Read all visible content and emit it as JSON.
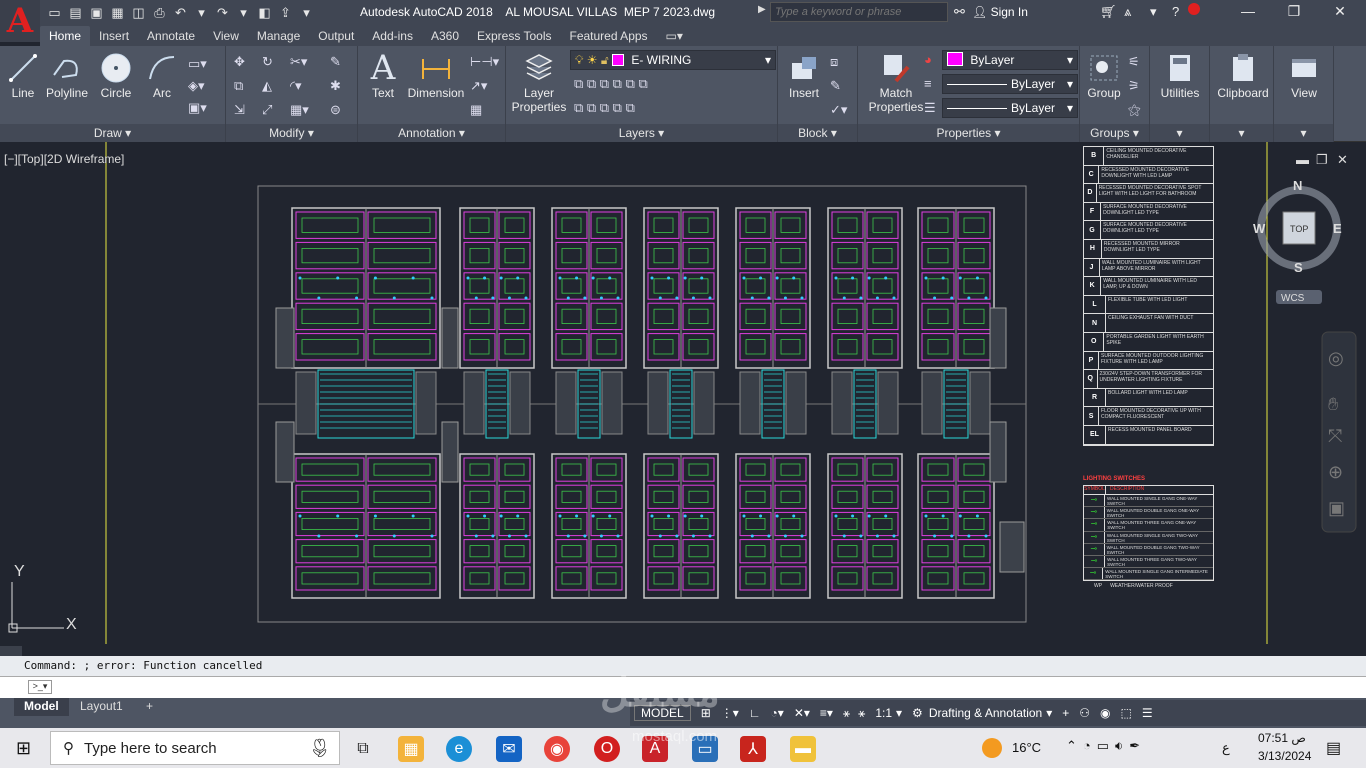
{
  "app": {
    "logo": "A",
    "title": "Autodesk AutoCAD 2018    AL MOUSAL VILLAS  MEP 7 2023.dwg"
  },
  "search": {
    "placeholder": "Type a keyword or phrase"
  },
  "account": {
    "signin": "Sign In"
  },
  "tabs": [
    "Home",
    "Insert",
    "Annotate",
    "View",
    "Manage",
    "Output",
    "Add-ins",
    "A360",
    "Express Tools",
    "Featured Apps"
  ],
  "draw": {
    "line": "Line",
    "polyline": "Polyline",
    "circle": "Circle",
    "arc": "Arc",
    "label": "Draw"
  },
  "modify": {
    "label": "Modify"
  },
  "annotation": {
    "text": "Text",
    "dimension": "Dimension",
    "label": "Annotation"
  },
  "layers": {
    "props1": "Layer",
    "props2": "Properties",
    "current": "E- WIRING",
    "label": "Layers"
  },
  "block": {
    "insert": "Insert",
    "label": "Block"
  },
  "properties": {
    "match1": "Match",
    "match2": "Properties",
    "color": "ByLayer",
    "linetype": "ByLayer",
    "lineweight": "ByLayer",
    "label": "Properties"
  },
  "groups": {
    "group": "Group",
    "label": "Groups"
  },
  "utilities": {
    "label": "Utilities"
  },
  "clipboard": {
    "label": "Clipboard"
  },
  "view": {
    "label": "View"
  },
  "viewport": {
    "label": "[−][Top][2D Wireframe]",
    "north": "N",
    "south": "S",
    "east": "E",
    "west": "W",
    "top": "TOP",
    "wcs": "WCS",
    "x": "X",
    "y": "Y"
  },
  "legend": {
    "rows": [
      {
        "sym": "B",
        "text": "CEILING MOUNTED DECORATIVE CHANDELIER"
      },
      {
        "sym": "C",
        "text": "RECESSED MOUNTED DECORATIVE DOWNLIGHT WITH LED LAMP"
      },
      {
        "sym": "D",
        "text": "RECESSED MOUNTED DECORATIVE SPOT LIGHT WITH LED LIGHT FOR BATHROOM"
      },
      {
        "sym": "F",
        "text": "SURFACE MOUNTED DECORATIVE DOWNLIGHT LED TYPE"
      },
      {
        "sym": "G",
        "text": "SURFACE MOUNTED DECORATIVE DOWNLIGHT LED TYPE"
      },
      {
        "sym": "H",
        "text": "RECESSED MOUNTED MIRROR DOWNLIGHT LED TYPE"
      },
      {
        "sym": "J",
        "text": "WALL MOUNTED LUMINAIRE WITH LIGHT LAMP ABOVE MIRROR"
      },
      {
        "sym": "K",
        "text": "WALL MOUNTED LUMINAIRE WITH LED LAMP, UP & DOWN"
      },
      {
        "sym": "L",
        "text": "FLEXIBLE TUBE WITH LED LIGHT"
      },
      {
        "sym": "N",
        "text": "CEILING EXHAUST FAN WITH DUCT"
      },
      {
        "sym": "O",
        "text": "PORTABLE GARDEN LIGHT WITH EARTH SPIKE"
      },
      {
        "sym": "P",
        "text": "SURFACE MOUNTED OUTDOOR LIGHTING FIXTURE WITH LED LAMP"
      },
      {
        "sym": "Q",
        "text": "230/24V STEP-DOWN TRANSFORMER FOR UNDERWATER LIGHTING FIXTURE"
      },
      {
        "sym": "R",
        "text": "BOLLARD LIGHT WITH LED LAMP"
      },
      {
        "sym": "S",
        "text": "FLOOR MOUNTED DECORATIVE UP WITH COMPACT FLUORESCENT"
      },
      {
        "sym": "EL",
        "text": "RECESS MOUNTED PANEL BOARD"
      }
    ],
    "switch_title": "LIGHTING SWITCHES",
    "switch_head_sym": "SYMBOL",
    "switch_head_desc": "DESCRIPTION",
    "switches": [
      "WALL MOUNTED SINGLE GANG ONE-WAY SWITCH",
      "WALL MOUNTED DOUBLE GANG ONE-WAY SWITCH",
      "WALL MOUNTED THREE GANG ONE-WAY SWITCH",
      "WALL MOUNTED SINGLE GANG TWO-WAY SWITCH",
      "WALL MOUNTED DOUBLE GANG TWO-WAY SWITCH",
      "WALL MOUNTED THREE GANG TWO-WAY SWITCH",
      "WALL MOUNTED SINGLE GANG INTERMEDIATE SWITCH"
    ],
    "wp": "WP",
    "wp_text": "WEATHER/WATER PROOF"
  },
  "command": {
    "history": "Command: ; error: Function cancelled",
    "prompt": ""
  },
  "layouts": [
    "Model",
    "Layout1"
  ],
  "status": {
    "model": "MODEL",
    "scale": "1:1",
    "workspace": "Drafting & Annotation"
  },
  "taskbar": {
    "search": "Type here to search",
    "temp": "16°C",
    "time": "07:51",
    "ampm": "ص",
    "date": "3/13/2024",
    "lang": "ع"
  },
  "watermark": {
    "text": "mostaql.com"
  }
}
